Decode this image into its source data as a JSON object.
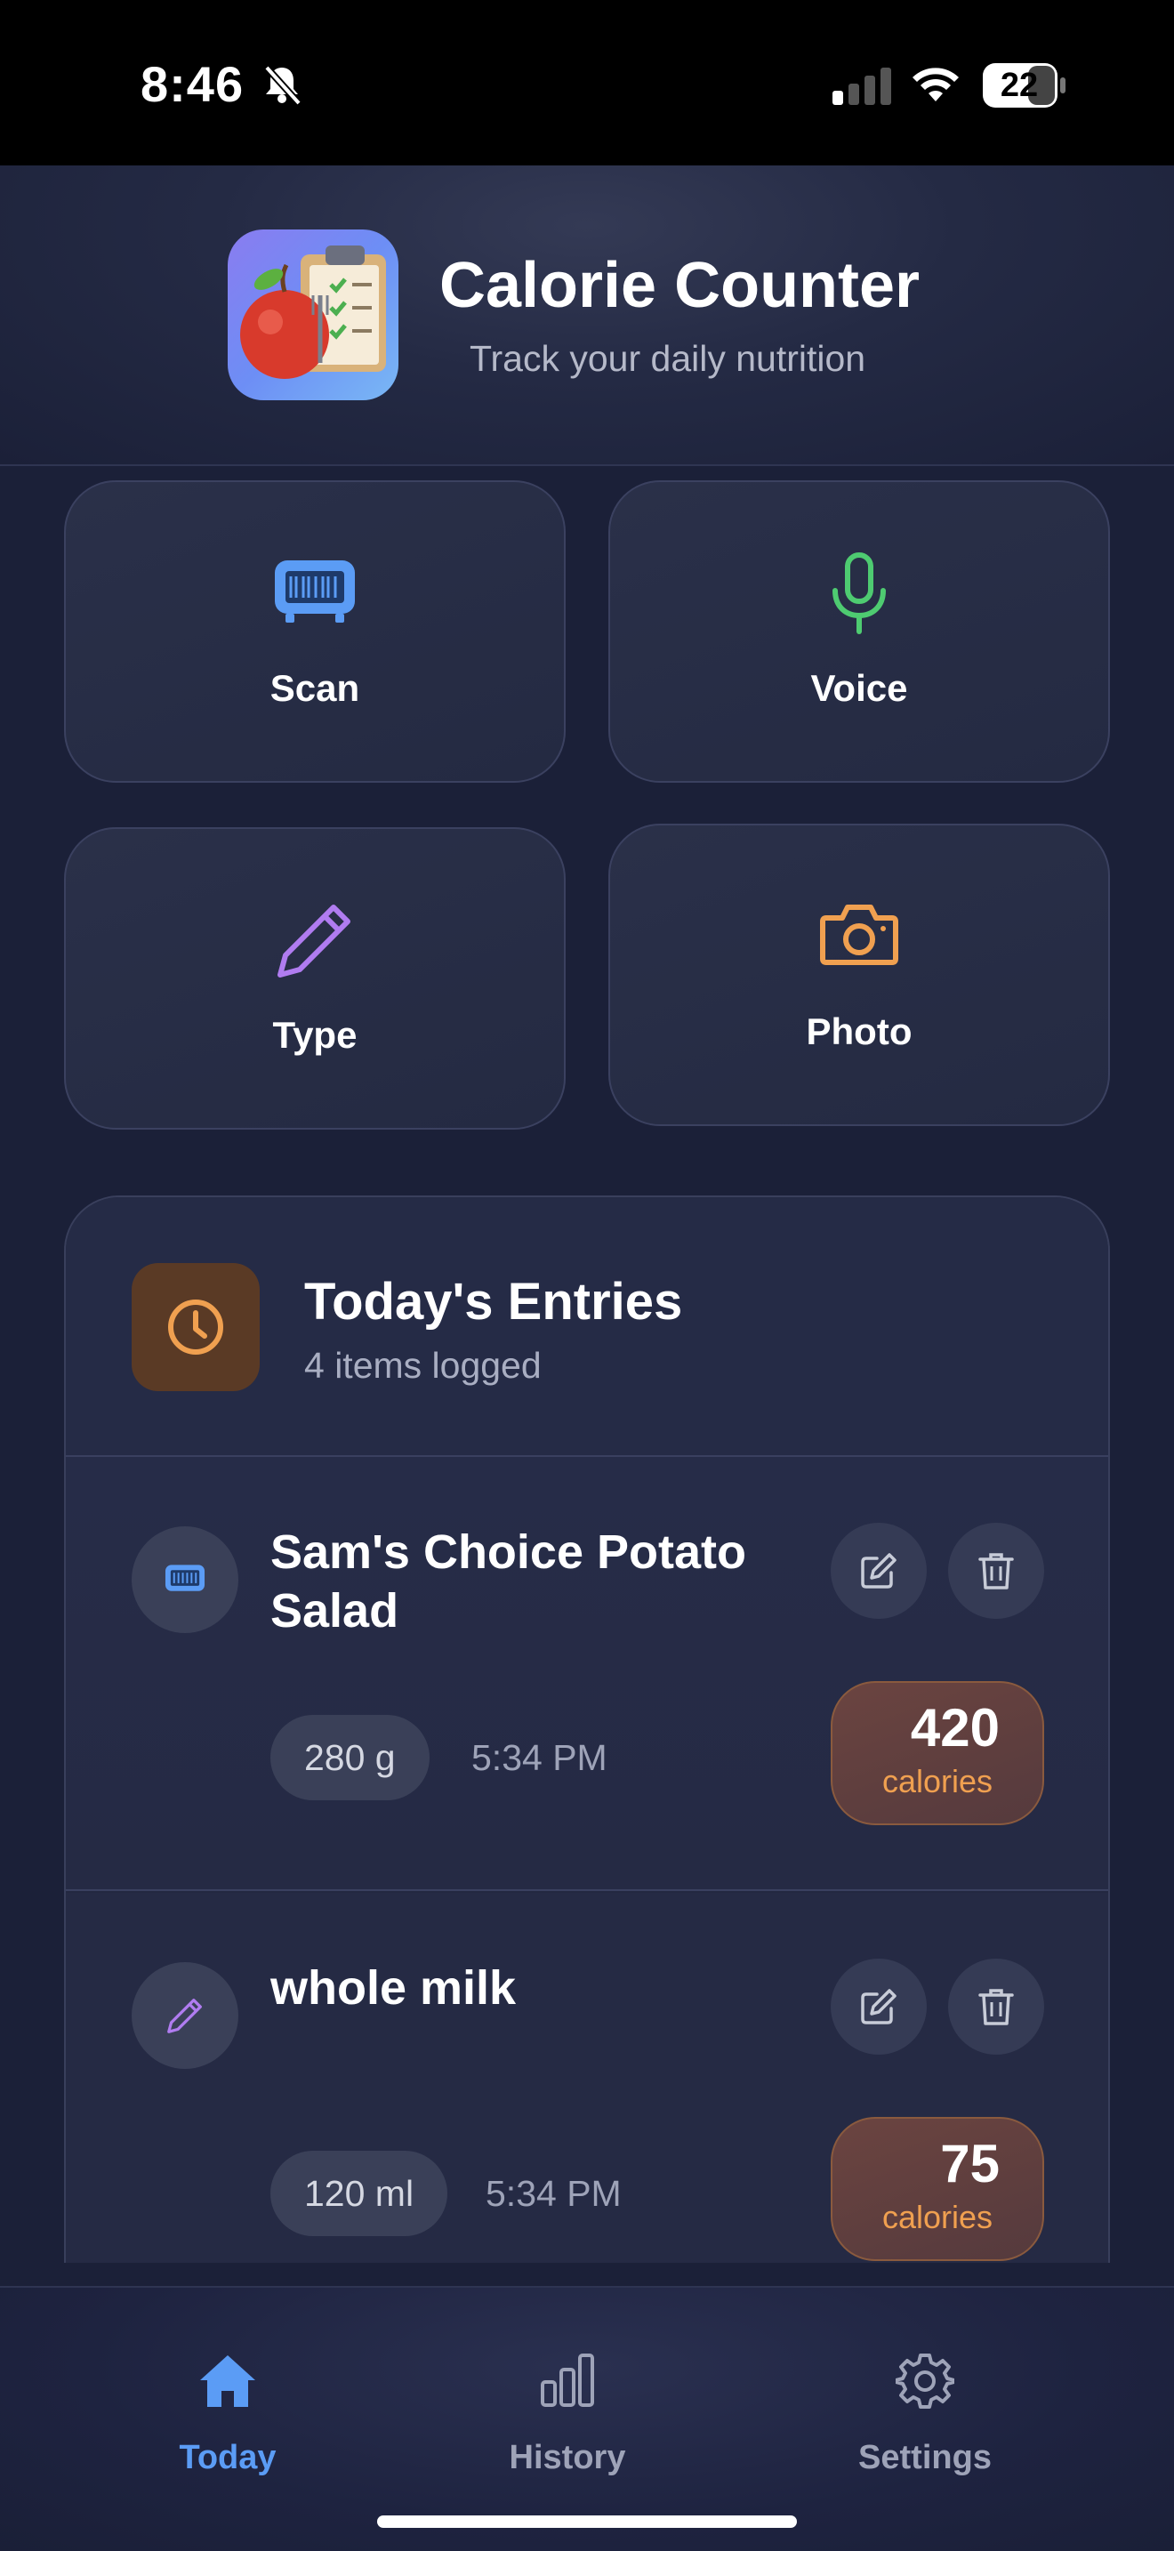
{
  "status_bar": {
    "time": "8:46",
    "battery": "22"
  },
  "header": {
    "title": "Calorie Counter",
    "subtitle": "Track your daily nutrition"
  },
  "actions": [
    {
      "label": "Scan",
      "icon": "barcode-scan-icon",
      "color": "#5b9cf5"
    },
    {
      "label": "Voice",
      "icon": "microphone-icon",
      "color": "#4ecb71"
    },
    {
      "label": "Type",
      "icon": "pencil-icon",
      "color": "#b07cf0"
    },
    {
      "label": "Photo",
      "icon": "camera-icon",
      "color": "#f0a050"
    }
  ],
  "entries_section": {
    "title": "Today's Entries",
    "subtitle": "4 items logged",
    "items": [
      {
        "name": "Sam's Choice Potato Salad",
        "quantity": "280 g",
        "time": "5:34 PM",
        "calories": "420",
        "calories_label": "calories",
        "source_icon": "barcode-scan-icon"
      },
      {
        "name": "whole milk",
        "quantity": "120 ml",
        "time": "5:34 PM",
        "calories": "75",
        "calories_label": "calories",
        "source_icon": "pencil-icon"
      }
    ]
  },
  "tabs": [
    {
      "label": "Today",
      "icon": "home-icon",
      "active": true
    },
    {
      "label": "History",
      "icon": "bar-chart-icon",
      "active": false
    },
    {
      "label": "Settings",
      "icon": "gear-icon",
      "active": false
    }
  ],
  "colors": {
    "accent": "#5b9cf5",
    "background": "#1b2038",
    "calorie_orange": "#f0a050"
  }
}
